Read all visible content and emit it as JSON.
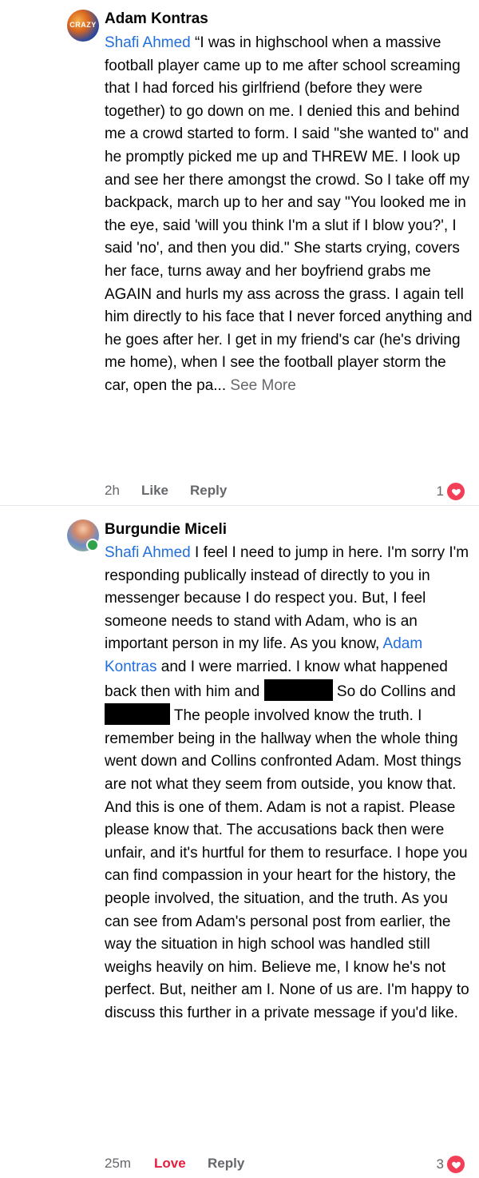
{
  "comments": [
    {
      "author": "Adam Kontras",
      "avatar_text": "CRAZY",
      "mention": "Shafi Ahmed",
      "text": " “I was in highschool when a massive football player came up to me after school screaming that I had forced his girlfriend (before they were together) to go down on me. I denied this and behind me a crowd started to form. I said \"she wanted to\" and he promptly picked me up and THREW ME. I look up and see her there amongst the crowd. So I take off my backpack, march up to her and say \"You looked me in the eye, said 'will you think I'm a slut if I blow you?', I said 'no', and then you did.\" She starts crying, covers her face, turns away and her boyfriend grabs me AGAIN and hurls my ass across the grass. I again tell him directly to his face that I never forced anything and he goes after her. I get in my friend's car (he's driving me home), when I see the football player storm the car, open the pa...",
      "see_more": "See More",
      "time": "2h",
      "like_label": "Like",
      "reply_label": "Reply",
      "reaction_count": "1",
      "reaction_icon": "heart-icon"
    },
    {
      "author": "Burgundie Miceli",
      "mention": "Shafi Ahmed",
      "text_a": " I feel I need to jump in here. I'm sorry I'm responding publically instead of directly to you in messenger because I do respect you. But, I feel someone needs to stand with Adam, who is an important person in my life. As you know, ",
      "mention2": "Adam Kontras",
      "text_b": " and I were married. I know what happened back then with him and ",
      "text_c": " So do Collins and ",
      "text_d": " The people involved know the truth. I remember being in the hallway when the whole thing went down and Collins confronted Adam. Most things are not what they seem from outside, you know that. And this is one of them. Adam is not a rapist. Please please know that. The accusations back then were unfair, and it's hurtful for them to resurface. I hope you can find compassion in your heart for the history, the people involved, the situation, and the truth. As you can see from Adam's personal post from earlier, the way the situation in high school was handled still weighs heavily on him. Believe me, I know he's not perfect. But, neither am I. None of us are. I'm happy to discuss this further in a private message if you'd like.",
      "time": "25m",
      "love_label": "Love",
      "reply_label": "Reply",
      "reaction_count": "3",
      "reaction_icon": "heart-icon",
      "online": true
    }
  ],
  "colors": {
    "mention": "#216fdb",
    "muted": "#65676b",
    "love": "#e41e3f",
    "heart": "#f33e58",
    "online": "#31a24c"
  }
}
